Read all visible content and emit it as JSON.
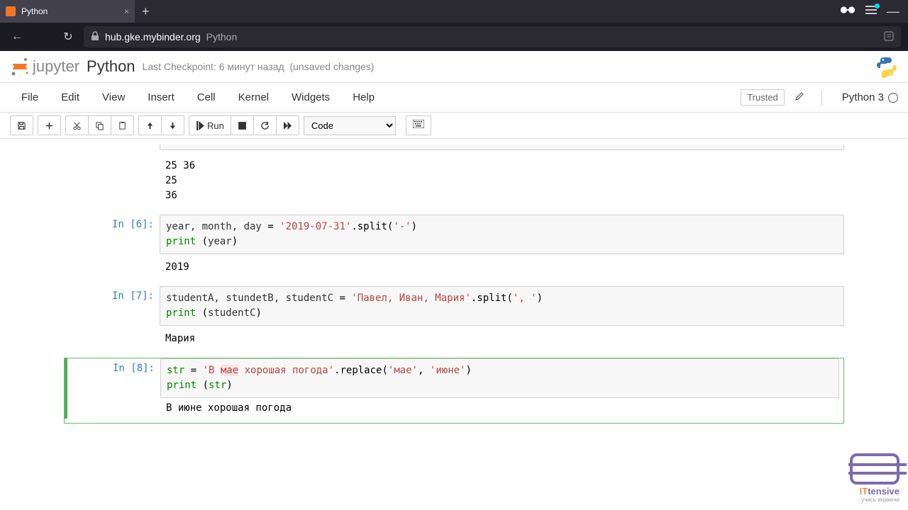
{
  "browser": {
    "tab_title": "Python",
    "url_domain": "hub.gke.mybinder.org",
    "url_path": "Python"
  },
  "header": {
    "logo_text": "jupyter",
    "notebook_name": "Python",
    "checkpoint": "Last Checkpoint: 6 минут назад",
    "unsaved": "(unsaved changes)"
  },
  "menubar": {
    "items": [
      "File",
      "Edit",
      "View",
      "Insert",
      "Cell",
      "Kernel",
      "Widgets",
      "Help"
    ],
    "trusted": "Trusted",
    "kernel": "Python 3"
  },
  "toolbar": {
    "run_label": "Run",
    "cell_type": "Code"
  },
  "cells": {
    "top_output": "25 36\n25\n36",
    "c6_prompt": "In [6]:",
    "c6_output": "2019",
    "c7_prompt": "In [7]:",
    "c7_output": "Мария",
    "c8_prompt": "In [8]:",
    "c8_output": "В июне хорошая погода"
  },
  "code": {
    "c6": {
      "vars": "year, month, day ",
      "eq": "= ",
      "str": "'2019-07-31'",
      "split": ".split(",
      "arg": "'-'",
      "close": ")",
      "print": "print ",
      "popen": "(",
      "pvar": "year",
      "pclose": ")"
    },
    "c7": {
      "vars": "studentA, stundetB, studentC ",
      "eq": "= ",
      "str": "'Павел, Иван, Мария'",
      "split": ".split(",
      "arg": "', '",
      "close": ")",
      "print": "print ",
      "popen": "(",
      "pvar": "studentC",
      "pclose": ")"
    },
    "c8": {
      "lhs": "str ",
      "eq": "= ",
      "str": "'В ",
      "str_err": "мае",
      "str2": " хорошая погода'",
      "repl": ".replace(",
      "a1": "'мае'",
      "comma": ", ",
      "a2": "'июне'",
      "close": ")",
      "print": "print ",
      "popen": "(",
      "pvar": "str",
      "pclose": ")"
    }
  },
  "watermark": {
    "it": "IT",
    "brand": "tensive",
    "sub": "учись играючи"
  }
}
